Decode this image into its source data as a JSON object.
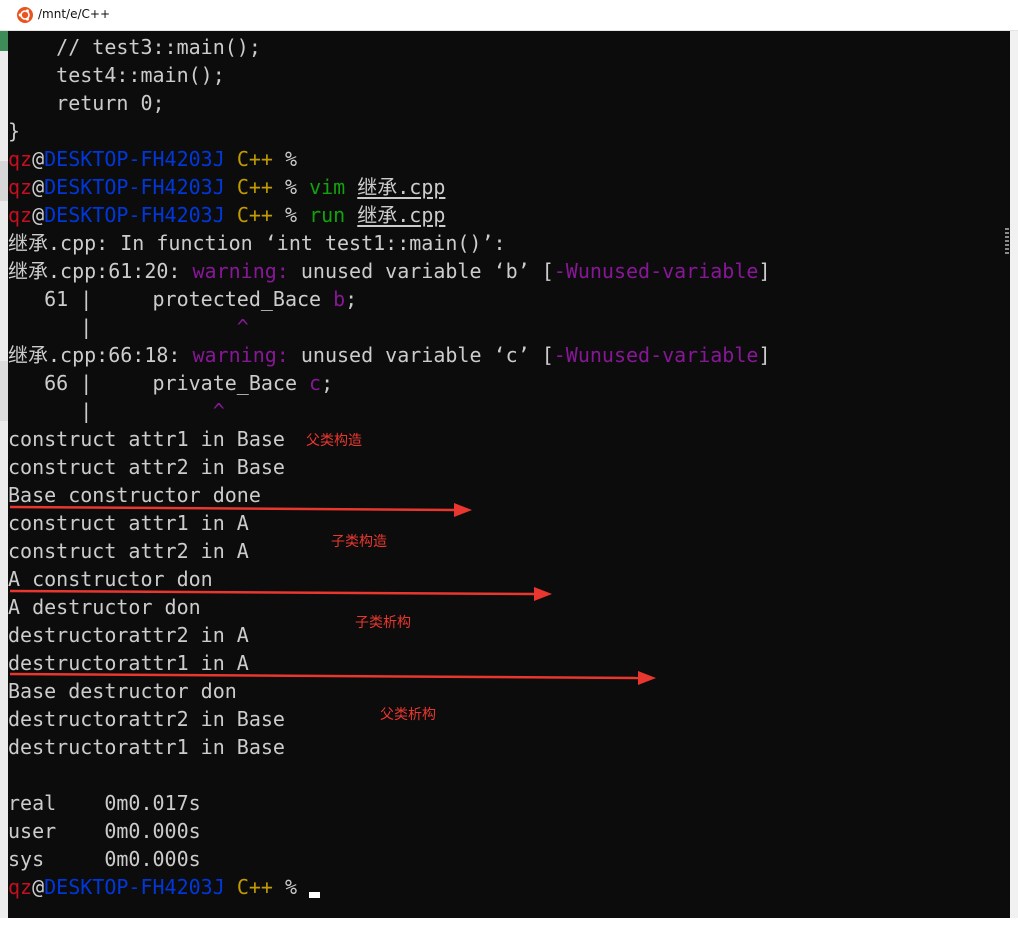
{
  "window": {
    "title": "/mnt/e/C++"
  },
  "prompt": {
    "user": "qz",
    "at": "@",
    "host": "DESKTOP-FH4203J",
    "dir": "C++",
    "symbol": "%"
  },
  "code": {
    "l1": "    // test3::main();",
    "l2": "    test4::main();",
    "l3": "    return 0;",
    "l4": "}"
  },
  "commands": {
    "vim": "vim",
    "run": "run",
    "file": "继承.cpp"
  },
  "compiler": {
    "in_function": "继承.cpp: In function ‘int test1::main()’:",
    "w1_loc": "继承.cpp:61:20: ",
    "warning_label": "warning:",
    "w1_msg": " unused variable ‘b’ [",
    "flag": "-Wunused-variable",
    "close_bracket": "]",
    "w1_src_lineno": "   61 |     protected_Bace ",
    "w1_var": "b",
    "semicolon": ";",
    "w1_gutter": "      |",
    "w1_caret": "                   ^",
    "w2_loc": "继承.cpp:66:18: ",
    "w2_msg": " unused variable ‘c’ [",
    "w2_src_lineno": "   66 |     private_Bace ",
    "w2_var": "c",
    "w2_gutter": "      |",
    "w2_caret": "                 ^"
  },
  "output": [
    "construct attr1 in Base",
    "construct attr2 in Base",
    "Base constructor done",
    "construct attr1 in A",
    "construct attr2 in A",
    "A constructor don",
    "A destructor don",
    "destructorattr2 in A",
    "destructorattr1 in A",
    "Base destructor don",
    "destructorattr2 in Base",
    "destructorattr1 in Base"
  ],
  "timing": {
    "real": "real    0m0.017s",
    "user": "user    0m0.000s",
    "sys": "sys     0m0.000s"
  },
  "annotations": {
    "parent_construct": "父类构造",
    "child_construct": "子类构造",
    "child_destruct": "子类析构",
    "parent_destruct": "父类析构"
  },
  "colors": {
    "background": "#0c0c0c",
    "text": "#cccccc",
    "user": "#c50f1f",
    "host": "#0037da",
    "dir": "#c19c00",
    "command": "#13a10e",
    "warning": "#881798",
    "annotation": "#e8372f"
  }
}
